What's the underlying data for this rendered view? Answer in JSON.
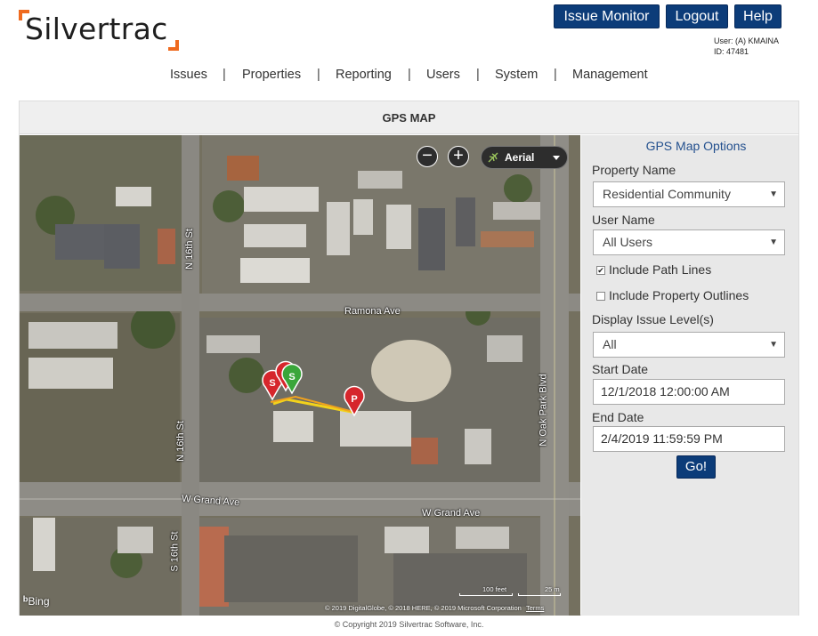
{
  "header": {
    "logo_text": "Silvertrac",
    "buttons": {
      "issue_monitor": "Issue Monitor",
      "logout": "Logout",
      "help": "Help"
    },
    "user_line": "User: (A) KMAINA",
    "id_line": "ID:  47481"
  },
  "nav": {
    "items": [
      "Issues",
      "Properties",
      "Reporting",
      "Users",
      "System",
      "Management"
    ],
    "separator": "|"
  },
  "panel": {
    "title": "GPS MAP"
  },
  "map": {
    "zoom_out": "−",
    "zoom_in": "+",
    "map_type": "Aerial",
    "streets": {
      "ramona": "Ramona Ave",
      "grand_left": "W Grand Ave",
      "grand_right": "W Grand Ave",
      "n16_top": "N 16th St",
      "n16_mid": "N 16th St",
      "s16": "S 16th St",
      "oak_park": "N Oak Park Blvd"
    },
    "markers": [
      {
        "letter": "S",
        "color": "#d6262c"
      },
      {
        "letter": "I",
        "color": "#d6262c"
      },
      {
        "letter": "S",
        "color": "#3aa63a"
      },
      {
        "letter": "P",
        "color": "#d6262c"
      }
    ],
    "bing_label": "Bing",
    "copyright": "© 2019 DigitalGlobe, © 2018 HERE, © 2019 Microsoft Corporation",
    "terms": "Terms",
    "scale_feet": "100 feet",
    "scale_m": "25 m"
  },
  "options": {
    "title": "GPS Map Options",
    "property_label": "Property Name",
    "property_value": "Residential Community",
    "user_label": "User Name",
    "user_value": "All Users",
    "path_lines_label": "Include Path Lines",
    "path_lines_checked": true,
    "outlines_label": "Include Property Outlines",
    "outlines_checked": false,
    "issue_level_label": "Display Issue Level(s)",
    "issue_level_value": "All",
    "start_label": "Start Date",
    "start_value": "12/1/2018 12:00:00 AM",
    "end_label": "End Date",
    "end_value": "2/4/2019 11:59:59 PM",
    "go_label": "Go!",
    "check_glyph": "✔",
    "arrow_glyph": "▼"
  },
  "footer": {
    "text": "© Copyright 2019 Silvertrac Software, Inc."
  },
  "colors": {
    "brand_blue": "#0c3c79",
    "logo_orange": "#ef6a1f",
    "link_blue": "#23508e"
  }
}
